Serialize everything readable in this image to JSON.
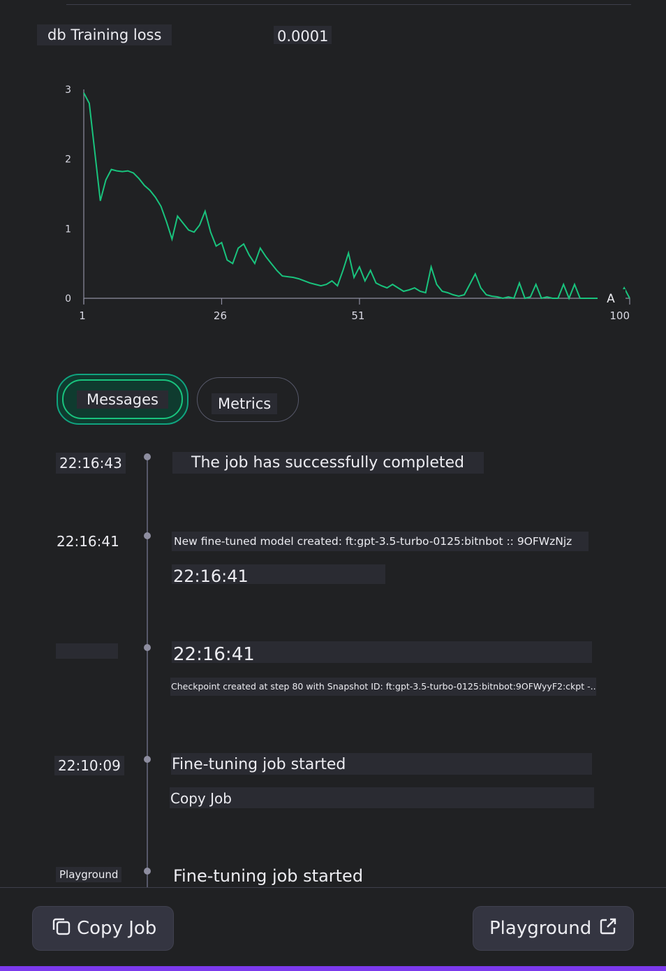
{
  "header": {
    "title": "db Training loss",
    "learning_rate": "0.0001"
  },
  "chart_data": {
    "type": "line",
    "title": "",
    "xlabel": "",
    "ylabel": "",
    "x_ticks": [
      "1",
      "26",
      "51",
      "100"
    ],
    "y_ticks": [
      "0",
      "1",
      "2",
      "3"
    ],
    "xlim": [
      1,
      100
    ],
    "ylim": [
      0,
      3
    ],
    "series": [
      {
        "color": "#19c37d",
        "values": [
          2.95,
          2.8,
          2.1,
          1.4,
          1.7,
          1.85,
          1.83,
          1.82,
          1.83,
          1.8,
          1.72,
          1.62,
          1.55,
          1.45,
          1.32,
          1.1,
          0.85,
          1.18,
          1.08,
          0.98,
          0.95,
          1.05,
          1.25,
          0.95,
          0.75,
          0.8,
          0.55,
          0.5,
          0.72,
          0.78,
          0.62,
          0.5,
          0.72,
          0.6,
          0.5,
          0.4,
          0.32,
          0.31,
          0.3,
          0.28,
          0.25,
          0.22,
          0.2,
          0.18,
          0.2,
          0.25,
          0.18,
          0.4,
          0.65,
          0.3,
          0.45,
          0.25,
          0.4,
          0.22,
          0.18,
          0.15,
          0.2,
          0.15,
          0.1,
          0.12,
          0.15,
          0.1,
          0.08,
          0.45,
          0.2,
          0.1,
          0.08,
          0.05,
          0.03,
          0.05,
          0.2,
          0.35,
          0.15,
          0.05,
          0.03,
          0.02,
          0.0,
          0.02,
          0.0,
          0.22,
          0.0,
          0.02,
          0.2,
          0.0,
          0.02,
          0.0,
          0.0,
          0.2,
          0.0,
          0.2,
          0.0,
          0.0,
          0.0,
          0.0,
          0.0,
          0.0,
          0.0,
          0.0,
          0.15,
          0.0
        ]
      }
    ],
    "annotation": "A",
    "grid": false
  },
  "tabs": [
    {
      "label": "Messages"
    },
    {
      "label": "Metrics"
    }
  ],
  "timeline": [
    {
      "time": "22:16:43",
      "message": "The job has successfully completed"
    },
    {
      "time": "22:16:41",
      "message": "New fine-tuned model created: ft:gpt-3.5-turbo-0125:bitnbot :: 9OFWzNjz",
      "extra": "22:16:41"
    },
    {
      "time": "",
      "heading": "22:16:41",
      "message": "Checkpoint created at step 80 with Snapshot ID: ft:gpt-3.5-turbo-0125:bitnbot:9OFWyyF2:ckpt -..."
    },
    {
      "time": "22:10:09",
      "message": "Fine-tuning job started",
      "extra": "Copy Job"
    },
    {
      "time": "Playground",
      "message": "Fine-tuning job started"
    }
  ],
  "footer": {
    "copy_label": "Copy Job",
    "copy_icon": "copy-icon",
    "playground_label": "Playground",
    "playground_icon": "external-link-icon"
  }
}
